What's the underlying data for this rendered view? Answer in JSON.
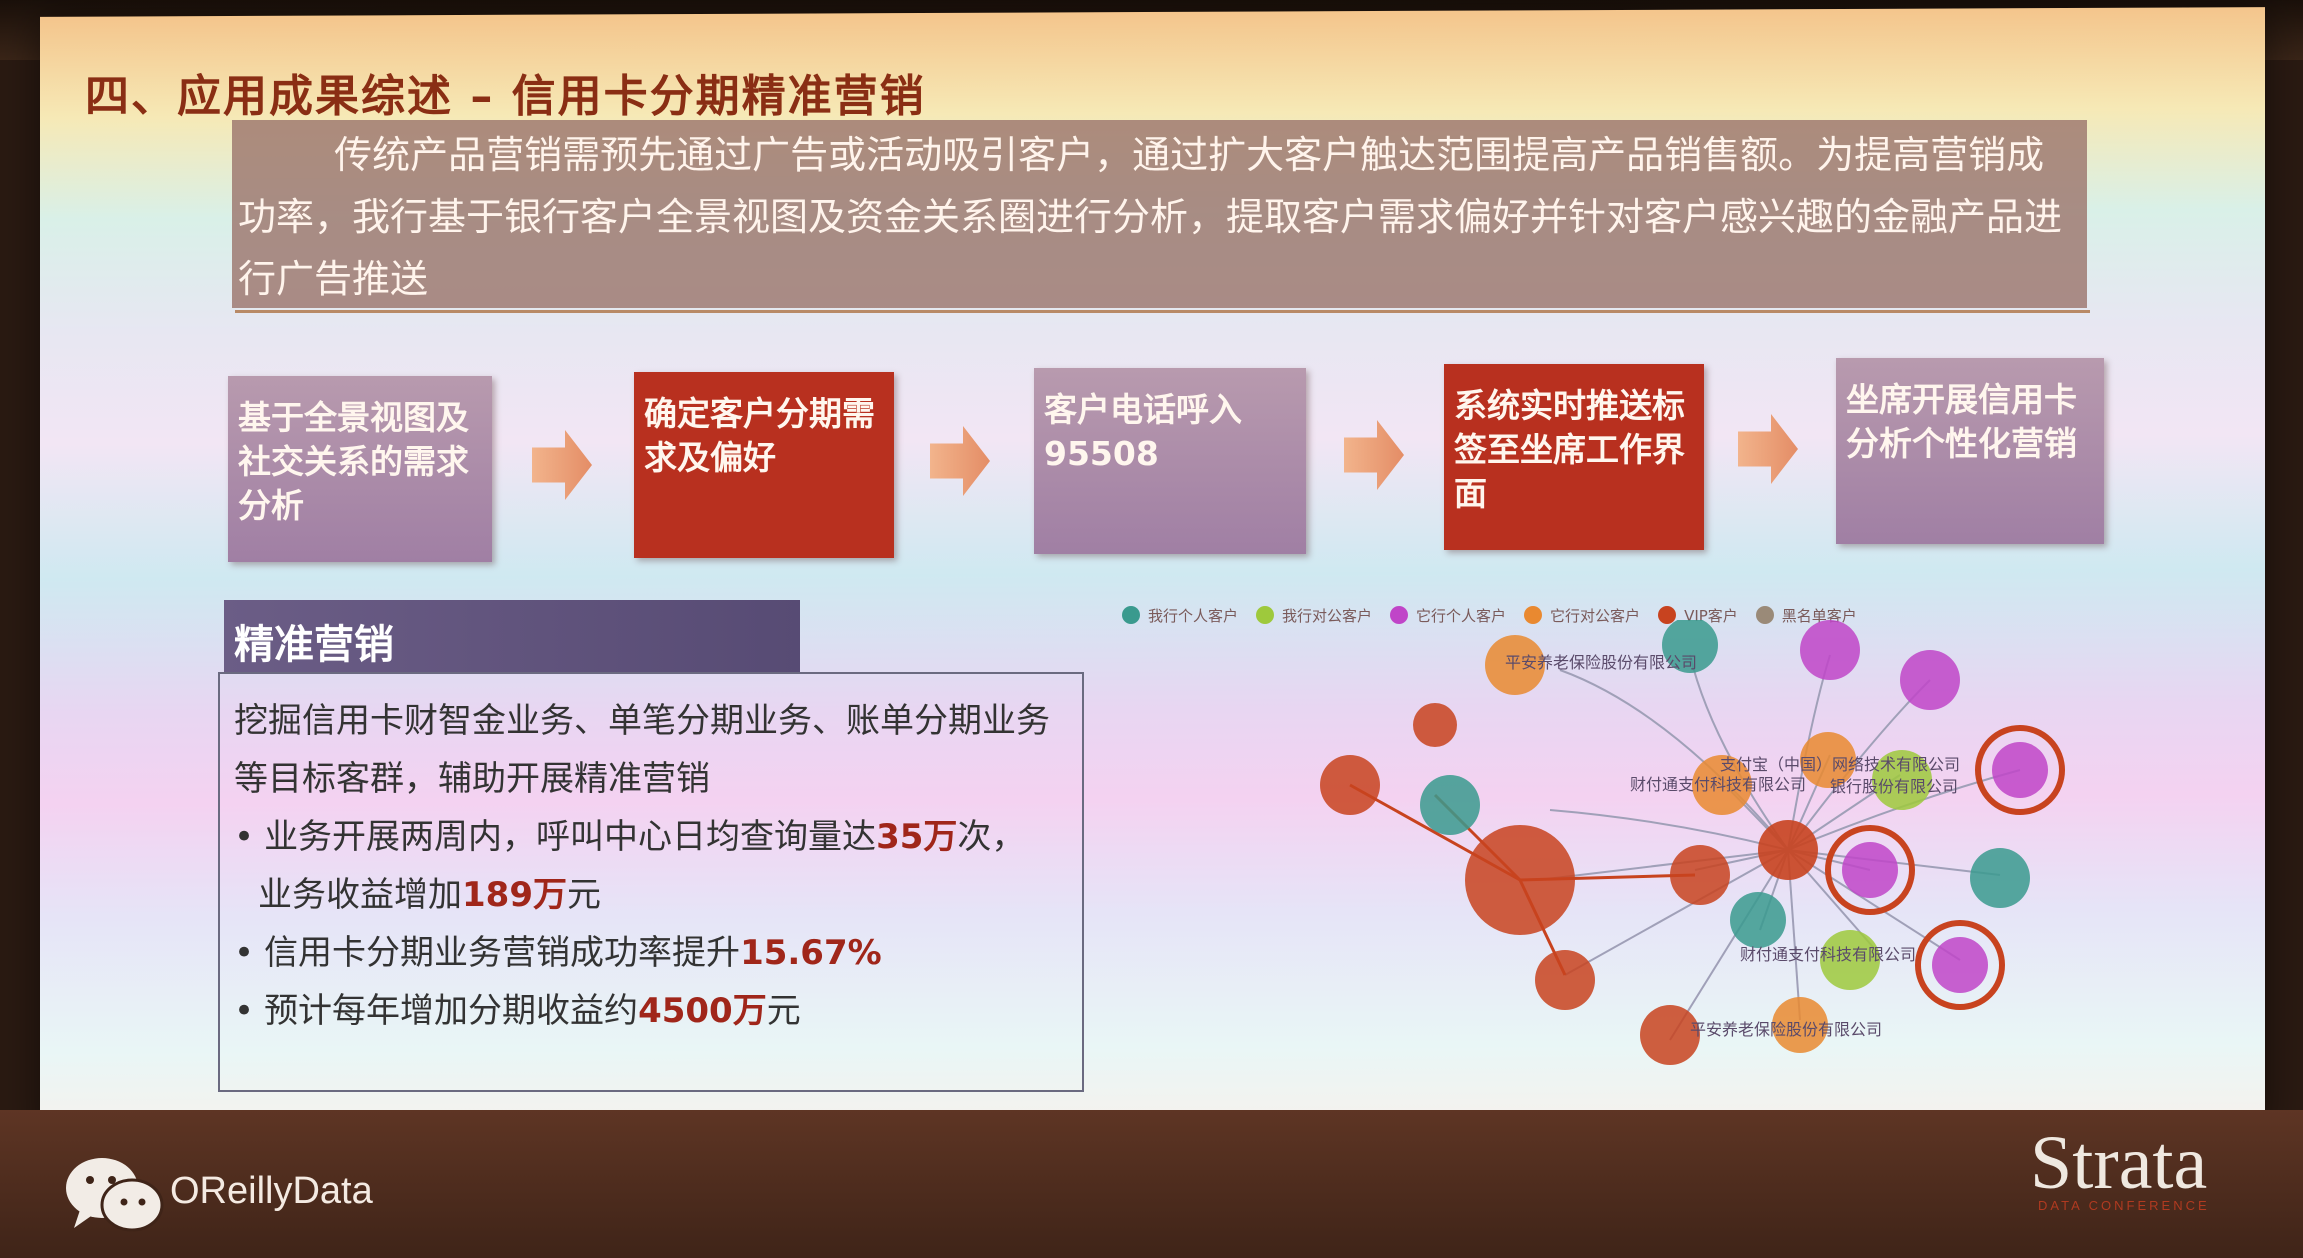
{
  "slide": {
    "title": "四、应用成果综述 – 信用卡分期精准营销",
    "intro": "传统产品营销需预先通过广告或活动吸引客户，通过扩大客户触达范围提高产品销售额。为提高营销成功率，我行基于银行客户全景视图及资金关系圈进行分析，提取客户需求偏好并针对客户感兴趣的金融产品进行广告推送"
  },
  "steps": [
    {
      "label": "基于全景视图及社交关系的需求分析",
      "style": "purple"
    },
    {
      "label": "确定客户分期需求及偏好",
      "style": "red"
    },
    {
      "label": "客户电话呼入95508",
      "style": "purple"
    },
    {
      "label": "系统实时推送标签至坐席工作界面",
      "style": "red"
    },
    {
      "label": "坐席开展信用卡分析个性化营销",
      "style": "purple"
    }
  ],
  "section": {
    "header": "精准营销",
    "line1": "挖掘信用卡财智金业务、单笔分期业务、账单分期业务等目标客群，辅助开展精准营销",
    "bullets": [
      {
        "pre": "业务开展两周内，呼叫中心日均查询量达",
        "hl": "35万",
        "post": "次，"
      },
      {
        "pre": "业务收益增加",
        "hl": "189万",
        "post": "元"
      },
      {
        "pre": "信用卡分期业务营销成功率提升",
        "hl": "15.67%",
        "post": ""
      },
      {
        "pre": "预计每年增加分期收益约",
        "hl": "4500万",
        "post": "元"
      }
    ]
  },
  "graph": {
    "legend": [
      {
        "label": "我行个人客户",
        "color": "#3a9a8e"
      },
      {
        "label": "我行对公客户",
        "color": "#9ec93c"
      },
      {
        "label": "它行个人客户",
        "color": "#c045c8"
      },
      {
        "label": "它行对公客户",
        "color": "#e98930"
      },
      {
        "label": "VIP客户",
        "color": "#c8431f"
      },
      {
        "label": "黑名单客户",
        "color": "#9a8a78"
      }
    ],
    "labels": [
      "平安养老保险股份有限公司",
      "支付宝（中国）网络技术有限公司",
      "财付通支付科技有限公司",
      "财付通支付科技有限公司",
      "平安养老保险股份有限公司",
      "银行股份有限公司"
    ]
  },
  "footer": {
    "brand": "OReillyData",
    "logo": "Strata",
    "logo_sub": "DATA CONFERENCE"
  }
}
